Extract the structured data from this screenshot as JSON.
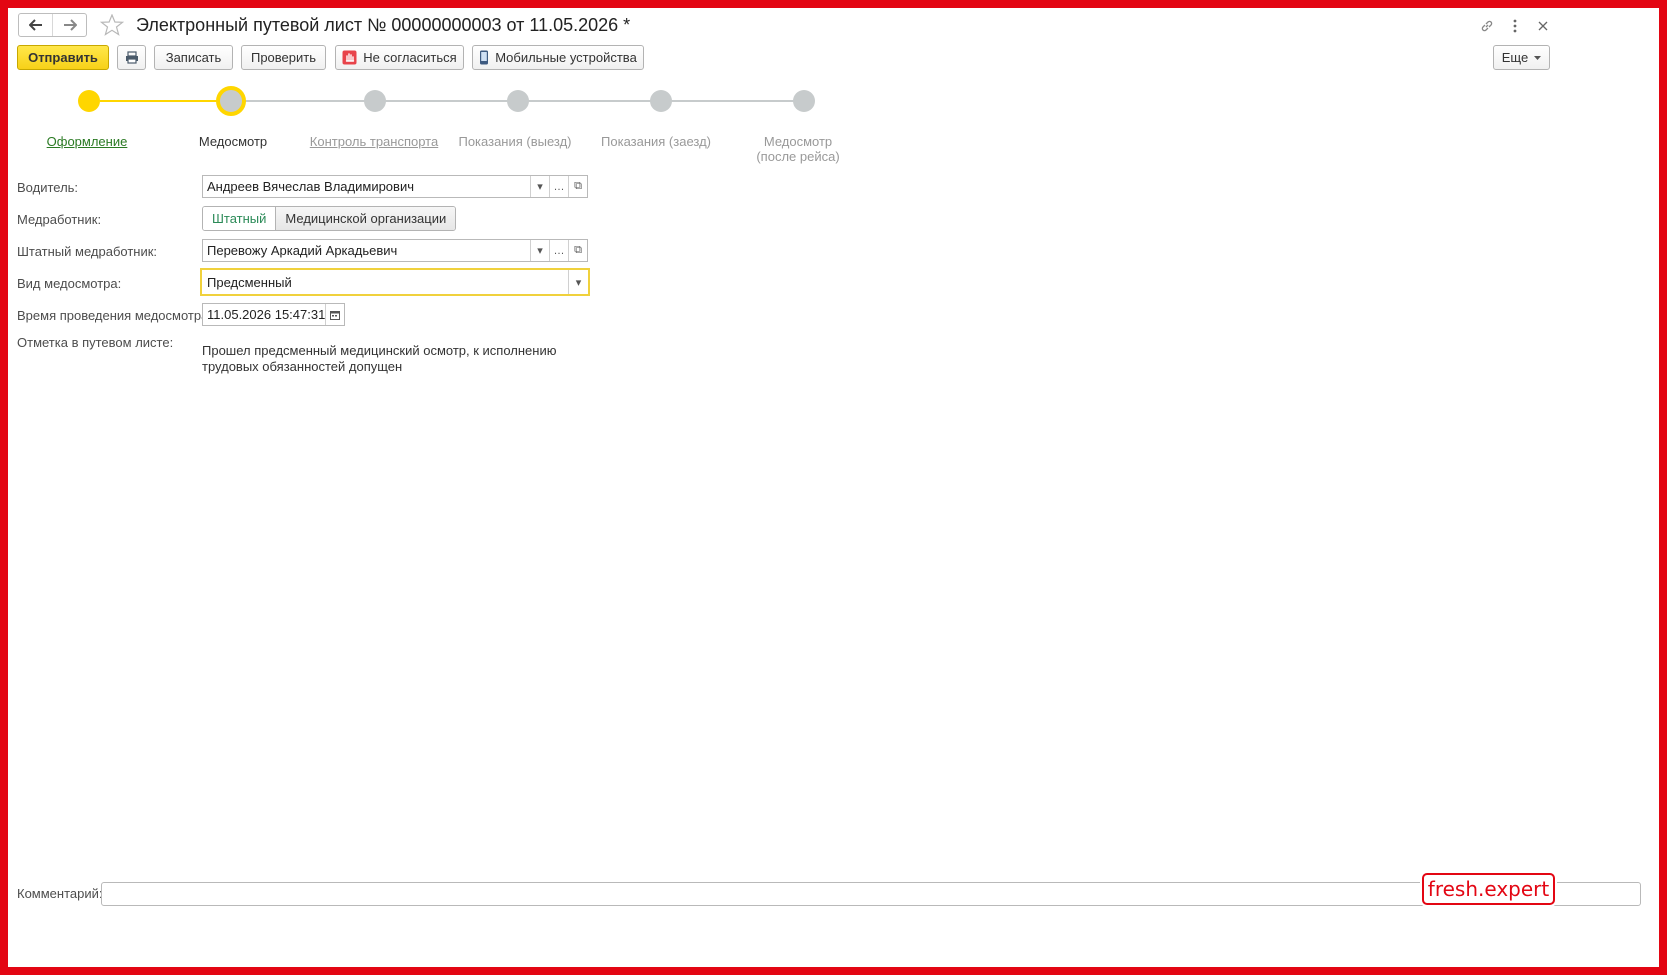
{
  "window": {
    "title": "Электронный путевой лист № 00000000003 от 11.05.2026 *"
  },
  "toolbar": {
    "send_label": "Отправить",
    "write_label": "Записать",
    "check_label": "Проверить",
    "disagree_label": "Не согласиться",
    "mobile_label": "Мобильные устройства",
    "more_label": "Еще"
  },
  "steps": [
    {
      "label": "Оформление",
      "state": "done"
    },
    {
      "label": "Медосмотр",
      "state": "current"
    },
    {
      "label": "Контроль транспорта",
      "state": "link"
    },
    {
      "label": "Показания (выезд)",
      "state": "pending"
    },
    {
      "label": "Показания (заезд)",
      "state": "pending"
    },
    {
      "label": "Медосмотр",
      "label2": "(после рейса)",
      "state": "pending"
    }
  ],
  "form": {
    "driver_label": "Водитель:",
    "driver_value": "Андреев Вячеслав Владимирович",
    "medworker_label": "Медработник:",
    "medworker_options": [
      "Штатный",
      "Медицинской организации"
    ],
    "medworker_selected": "Штатный",
    "staff_medworker_label": "Штатный медработник:",
    "staff_medworker_value": "Перевожу Аркадий Аркадьевич",
    "exam_type_label": "Вид медосмотра:",
    "exam_type_value": "Предсменный",
    "exam_time_label": "Время проведения медосмотра:",
    "exam_time_value": "11.05.2026 15:47:31",
    "note_label": "Отметка в путевом листе:",
    "note_line1": "Прошел предсменный медицинский осмотр, к исполнению",
    "note_line2": "трудовых обязанностей допущен"
  },
  "comment": {
    "label": "Комментарий:",
    "value": ""
  },
  "watermark": "fresh.expert",
  "colors": {
    "accent_yellow": "#ffd600",
    "frame_red": "#e30613",
    "step_pending": "#c7cbcc",
    "link_green": "#2a7a23"
  }
}
